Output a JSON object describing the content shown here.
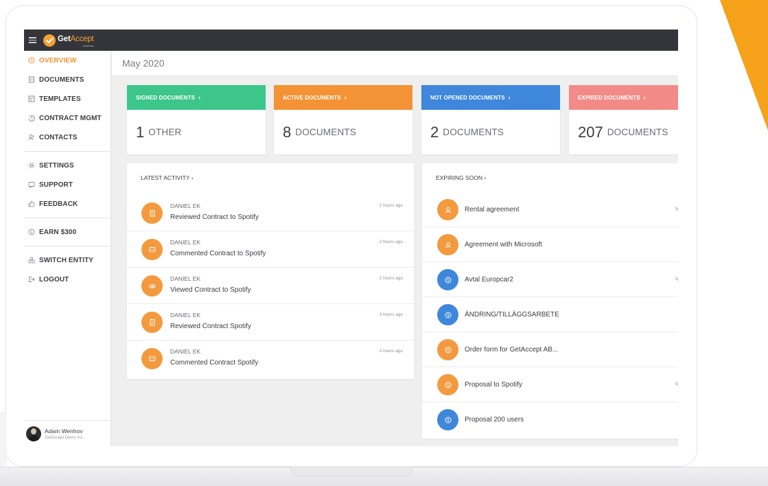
{
  "app": {
    "brand_main": "Get",
    "brand_accent": "Accept",
    "brand_sub": "business"
  },
  "colors": {
    "brand_orange": "#f6a032",
    "active_nav": "#f39336",
    "signed": "#3cc68a",
    "active": "#f39336",
    "not_opened": "#3e87db",
    "expired": "#f28b87",
    "activity_orange": "#f39a3f",
    "expiring_blue": "#3e87db",
    "topbar": "#34353a"
  },
  "sidebar": {
    "items": [
      {
        "icon": "clock-icon",
        "label": "OVERVIEW",
        "active": true
      },
      {
        "icon": "document-icon",
        "label": "DOCUMENTS"
      },
      {
        "icon": "template-icon",
        "label": "TEMPLATES"
      },
      {
        "icon": "history-icon",
        "label": "CONTRACT MGMT"
      },
      {
        "icon": "contacts-icon",
        "label": "CONTACTS"
      },
      {
        "icon": "gear-icon",
        "label": "SETTINGS"
      },
      {
        "icon": "chat-icon",
        "label": "SUPPORT"
      },
      {
        "icon": "thumbs-up-icon",
        "label": "FEEDBACK"
      },
      {
        "icon": "dollar-icon",
        "label": "EARN $300"
      },
      {
        "icon": "building-icon",
        "label": "SWITCH ENTITY"
      },
      {
        "icon": "logout-icon",
        "label": "LOGOUT"
      }
    ],
    "profile": {
      "name": "Adam Wenhov",
      "company": "GetAccept Demo Inc."
    }
  },
  "main": {
    "period": "May 2020"
  },
  "cards": [
    {
      "title": "SIGNED DOCUMENTS",
      "chevron": "›",
      "count": "1",
      "unit": "OTHER",
      "color": "#3cc68a"
    },
    {
      "title": "ACTIVE DOCUMENTS",
      "chevron": "›",
      "count": "8",
      "unit": "DOCUMENTS",
      "color": "#f39336"
    },
    {
      "title": "NOT OPENED DOCUMENTS",
      "chevron": "›",
      "count": "2",
      "unit": "DOCUMENTS",
      "color": "#3e87db"
    },
    {
      "title": "EXPIRED DOCUMENTS",
      "chevron": "›",
      "count": "207",
      "unit": "DOCUMENTS",
      "color": "#f28b87"
    }
  ],
  "latest_activity": {
    "title": "LATEST ACTIVITY  ›",
    "items": [
      {
        "icon": "review-icon",
        "name": "DANIEL EK",
        "action": "Reviewed Contract to Spotify",
        "time": "2 hours ago"
      },
      {
        "icon": "comment-icon",
        "name": "DANIEL EK",
        "action": "Commented Contract to Spotify",
        "time": "2 hours ago"
      },
      {
        "icon": "eye-icon",
        "name": "DANIEL EK",
        "action": "Viewed Contract to Spotify",
        "time": "2 hours ago"
      },
      {
        "icon": "review-icon",
        "name": "DANIEL EK",
        "action": "Reviewed Contract Spotify",
        "time": "3 hours ago"
      },
      {
        "icon": "comment-icon",
        "name": "DANIEL EK",
        "action": "Commented Contract Spotify",
        "time": "3 hours ago"
      }
    ]
  },
  "expiring_soon": {
    "title": "EXPIRING SOON ›",
    "items": [
      {
        "icon": "user-icon",
        "color": "orange",
        "label": "Rental agreement",
        "extra": "Sp"
      },
      {
        "icon": "user-icon",
        "color": "orange",
        "label": "Agreement with Microsoft",
        "extra": ""
      },
      {
        "icon": "dollar-icon",
        "color": "blue",
        "label": "Avtal Europcar2",
        "extra": "Sp"
      },
      {
        "icon": "dollar-icon",
        "color": "blue",
        "label": "ÄNDRING/TILLÄGGSARBETE",
        "extra": ""
      },
      {
        "icon": "dollar-icon",
        "color": "orange",
        "label": "Order form for GetAccept AB...",
        "extra": ""
      },
      {
        "icon": "dollar-icon",
        "color": "orange",
        "label": "Proposal to Spotify",
        "extra": "Sp"
      },
      {
        "icon": "dollar-icon",
        "color": "blue",
        "label": "Proposal 200 users",
        "extra": ""
      }
    ]
  }
}
